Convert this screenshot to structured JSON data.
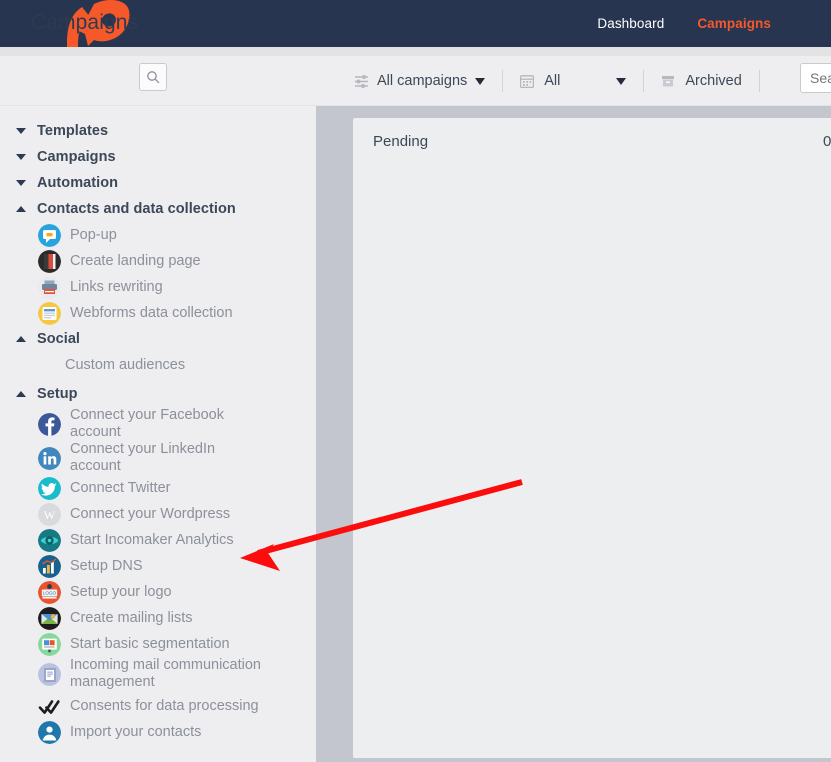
{
  "header": {
    "logo_icon": "rocket-logo-icon",
    "nav": [
      {
        "label": "Dashboard",
        "active": false
      },
      {
        "label": "Campaigns",
        "active": true
      }
    ],
    "colors": {
      "bar_bg": "#283550",
      "active": "#f5592a",
      "inactive": "#ffffff"
    }
  },
  "toolbar": {
    "page_title": "Campaigns",
    "title_search_icon": "search-icon",
    "filters": [
      {
        "icon": "sliders-icon",
        "label": "All campaigns",
        "caret": true
      },
      {
        "icon": "calendar-icon",
        "label": "All",
        "caret": true
      },
      {
        "icon": "archive-box-icon",
        "label": "Archived",
        "caret": false
      }
    ],
    "search": {
      "value": "",
      "placeholder": "Search"
    }
  },
  "sidebar": {
    "groups": [
      {
        "label": "Templates",
        "expanded": false,
        "items": []
      },
      {
        "label": "Campaigns",
        "expanded": false,
        "items": []
      },
      {
        "label": "Automation",
        "expanded": false,
        "items": []
      },
      {
        "label": "Contacts and data collection",
        "expanded": true,
        "items": [
          {
            "label": "Pop-up",
            "icon": "popup-chat-icon"
          },
          {
            "label": "Create landing page",
            "icon": "landing-page-icon"
          },
          {
            "label": "Links rewriting",
            "icon": "printer-links-icon"
          },
          {
            "label": "Webforms data collection",
            "icon": "webform-icon"
          }
        ]
      },
      {
        "label": "Social",
        "expanded": true,
        "items": [
          {
            "label": "Custom audiences",
            "icon": null
          }
        ]
      },
      {
        "label": "Setup",
        "expanded": true,
        "items": [
          {
            "label": "Connect your Facebook account",
            "icon": "facebook-icon"
          },
          {
            "label": "Connect your LinkedIn account",
            "icon": "linkedin-icon"
          },
          {
            "label": "Connect Twitter",
            "icon": "twitter-icon"
          },
          {
            "label": "Connect your Wordpress",
            "icon": "wordpress-icon"
          },
          {
            "label": "Start Incomaker Analytics",
            "icon": "analytics-eye-icon"
          },
          {
            "label": "Setup DNS",
            "icon": "dns-chart-icon"
          },
          {
            "label": "Setup your logo",
            "icon": "logo-badge-icon"
          },
          {
            "label": "Create mailing lists",
            "icon": "mail-envelope-icon"
          },
          {
            "label": "Start basic segmentation",
            "icon": "segmentation-screen-icon"
          },
          {
            "label": "Incoming mail communication management",
            "icon": "mailbox-icon"
          },
          {
            "label": "Consents for data processing",
            "icon": "double-check-icon"
          },
          {
            "label": "Import your contacts",
            "icon": "import-contacts-icon"
          }
        ]
      }
    ]
  },
  "main": {
    "column": {
      "title": "Pending",
      "count": "0"
    }
  },
  "annotation": {
    "arrow_color": "#fc0d0d",
    "arrow_from": "522,482",
    "arrow_to": "243,557",
    "points_at": "Start Incomaker Analytics"
  }
}
